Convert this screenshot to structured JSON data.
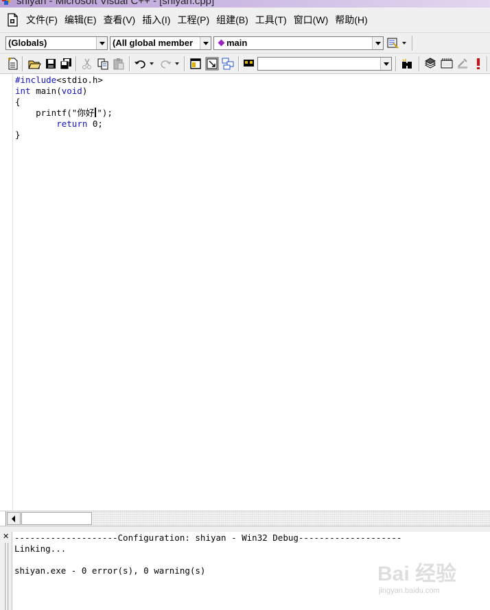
{
  "window": {
    "title": "shiyan - Microsoft Visual C++ - [shiyan.cpp]"
  },
  "menu": {
    "items": [
      "文件(F)",
      "编辑(E)",
      "查看(V)",
      "插入(I)",
      "工程(P)",
      "组建(B)",
      "工具(T)",
      "窗口(W)",
      "帮助(H)"
    ]
  },
  "wizardbar": {
    "class_combo": "(Globals)",
    "filter_combo": "(All global member",
    "member_combo": "main",
    "member_icon": "purple-diamond-icon"
  },
  "standard_toolbar": {
    "find_combo_value": ""
  },
  "editor": {
    "lines": [
      {
        "kw": "#include",
        "rest": "<stdio.h>"
      },
      {
        "kw": "int",
        "rest": " main(",
        "kw2": "void",
        "rest2": ")"
      },
      {
        "text": "{"
      },
      {
        "indent": "    ",
        "text_before": "printf(\"你好",
        "text_after": "\");"
      },
      {
        "indent": "        ",
        "kw": "return",
        "rest": " 0;"
      },
      {
        "text": "}"
      }
    ]
  },
  "output": {
    "lines": [
      "--------------------Configuration: shiyan - Win32 Debug--------------------",
      "Linking...",
      "",
      "shiyan.exe - 0 error(s), 0 warning(s)"
    ]
  },
  "watermark": {
    "brand": "Bai 经验",
    "url": "jingyan.baidu.com"
  },
  "colors": {
    "keyword": "#1010c0",
    "title_bar": "#c9b5e2",
    "chrome": "#f0f0f0"
  }
}
